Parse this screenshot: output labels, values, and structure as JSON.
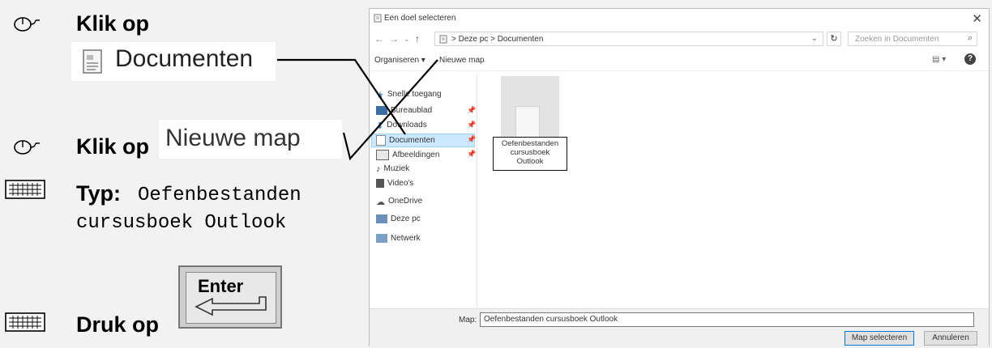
{
  "instructions": {
    "step1": {
      "action": "Klik op",
      "target": "Documenten"
    },
    "step2": {
      "action": "Klik op",
      "target": "Nieuwe map"
    },
    "step3": {
      "action": "Typ:",
      "text_line1": "Oefenbestanden",
      "text_line2": "cursusboek Outlook"
    },
    "step4": {
      "action": "Druk op",
      "key": "Enter"
    }
  },
  "dialog": {
    "title": "Een doel selecteren",
    "address": {
      "path": "> Deze pc > Documenten"
    },
    "search_placeholder": "Zoeken in Documenten",
    "toolbar": {
      "organize": "Organiseren ▾",
      "new_folder": "Nieuwe map",
      "view": "▤ ▾",
      "help": "?"
    },
    "nav_items": [
      {
        "label": "Snelle toegang",
        "icon": "star-icon",
        "pinned": false
      },
      {
        "label": "Bureaublad",
        "icon": "desktop-icon",
        "pinned": true
      },
      {
        "label": "Downloads",
        "icon": "download-icon",
        "pinned": true
      },
      {
        "label": "Documenten",
        "icon": "document-icon",
        "pinned": true,
        "selected": true
      },
      {
        "label": "Afbeeldingen",
        "icon": "image-icon",
        "pinned": true
      },
      {
        "label": "Muziek",
        "icon": "music-icon",
        "pinned": false
      },
      {
        "label": "Video's",
        "icon": "video-icon",
        "pinned": false
      },
      {
        "label": "OneDrive",
        "icon": "cloud-icon",
        "pinned": false
      },
      {
        "label": "Deze pc",
        "icon": "computer-icon",
        "pinned": false
      },
      {
        "label": "Netwerk",
        "icon": "network-icon",
        "pinned": false
      }
    ],
    "new_folder_name_lines": [
      "Oefenbestanden",
      "cursusboek",
      "Outlook"
    ],
    "folder_label": "Map:",
    "folder_value": "Oefenbestanden cursusboek Outlook",
    "select_button": "Map selecteren",
    "cancel_button": "Annuleren"
  }
}
